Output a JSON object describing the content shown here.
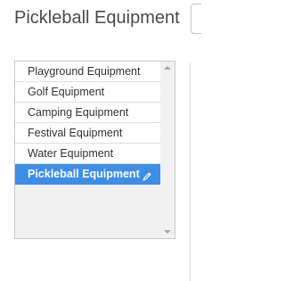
{
  "header": {
    "title": "Pickleball Equipment"
  },
  "list": {
    "items": [
      {
        "label": "Playground Equipment",
        "selected": false
      },
      {
        "label": "Golf Equipment",
        "selected": false
      },
      {
        "label": "Camping Equipment",
        "selected": false
      },
      {
        "label": "Festival Equipment",
        "selected": false
      },
      {
        "label": "Water Equipment",
        "selected": false
      },
      {
        "label": "Pickleball Equipment",
        "selected": true
      }
    ],
    "selected_icon": "pencil-edit-icon"
  },
  "colors": {
    "selected_bg": "#3d8ee8",
    "title_text": "#4a4a4a"
  }
}
